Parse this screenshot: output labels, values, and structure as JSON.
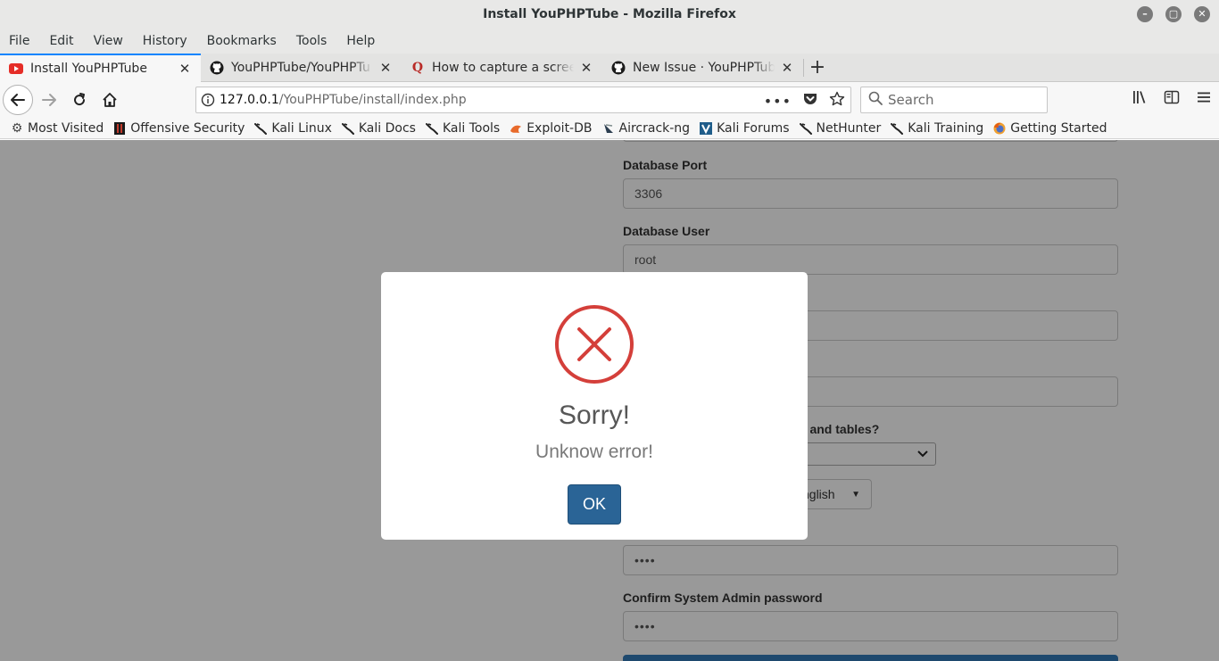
{
  "window": {
    "title": "Install YouPHPTube - Mozilla Firefox",
    "controls": [
      "minimize",
      "maximize",
      "close"
    ]
  },
  "menu": {
    "items": [
      "File",
      "Edit",
      "View",
      "History",
      "Bookmarks",
      "Tools",
      "Help"
    ]
  },
  "tabs": [
    {
      "label": "Install YouPHPTube",
      "icon": "youtube-icon",
      "active": true
    },
    {
      "label": "YouPHPTube/YouPHPTu",
      "icon": "github-icon",
      "active": false
    },
    {
      "label": "How to capture a screens",
      "icon": "quora-icon",
      "active": false
    },
    {
      "label": "New Issue · YouPHPTube",
      "icon": "github-icon",
      "active": false
    }
  ],
  "url": {
    "host": "127.0.0.1",
    "path": "/YouPHPTube/install/index.php"
  },
  "search": {
    "placeholder": "Search"
  },
  "bookmarks": [
    {
      "label": "Most Visited",
      "icon": "gear-icon"
    },
    {
      "label": "Offensive Security",
      "icon": "offsec-icon"
    },
    {
      "label": "Kali Linux",
      "icon": "kali-icon"
    },
    {
      "label": "Kali Docs",
      "icon": "kali-icon"
    },
    {
      "label": "Kali Tools",
      "icon": "kali-icon"
    },
    {
      "label": "Exploit-DB",
      "icon": "exploitdb-icon"
    },
    {
      "label": "Aircrack-ng",
      "icon": "aircrack-icon"
    },
    {
      "label": "Kali Forums",
      "icon": "kali-forums-icon"
    },
    {
      "label": "NetHunter",
      "icon": "kali-icon"
    },
    {
      "label": "Kali Training",
      "icon": "kali-icon"
    },
    {
      "label": "Getting Started",
      "icon": "firefox-icon"
    }
  ],
  "form": {
    "db_port_label": "Database Port",
    "db_port_value": "3306",
    "db_user_label": "Database User",
    "db_user_value": "root",
    "create_db_label_fragment": "se and tables?",
    "language_fragment": "nglish",
    "admin_password_value": "••••",
    "confirm_password_label": "Confirm System Admin password",
    "confirm_password_value": "••••"
  },
  "dialog": {
    "title": "Sorry!",
    "message": "Unknow error!",
    "ok_label": "OK",
    "icon": "error-x-icon",
    "icon_color": "#d43f3a",
    "button_color": "#2a6496"
  }
}
